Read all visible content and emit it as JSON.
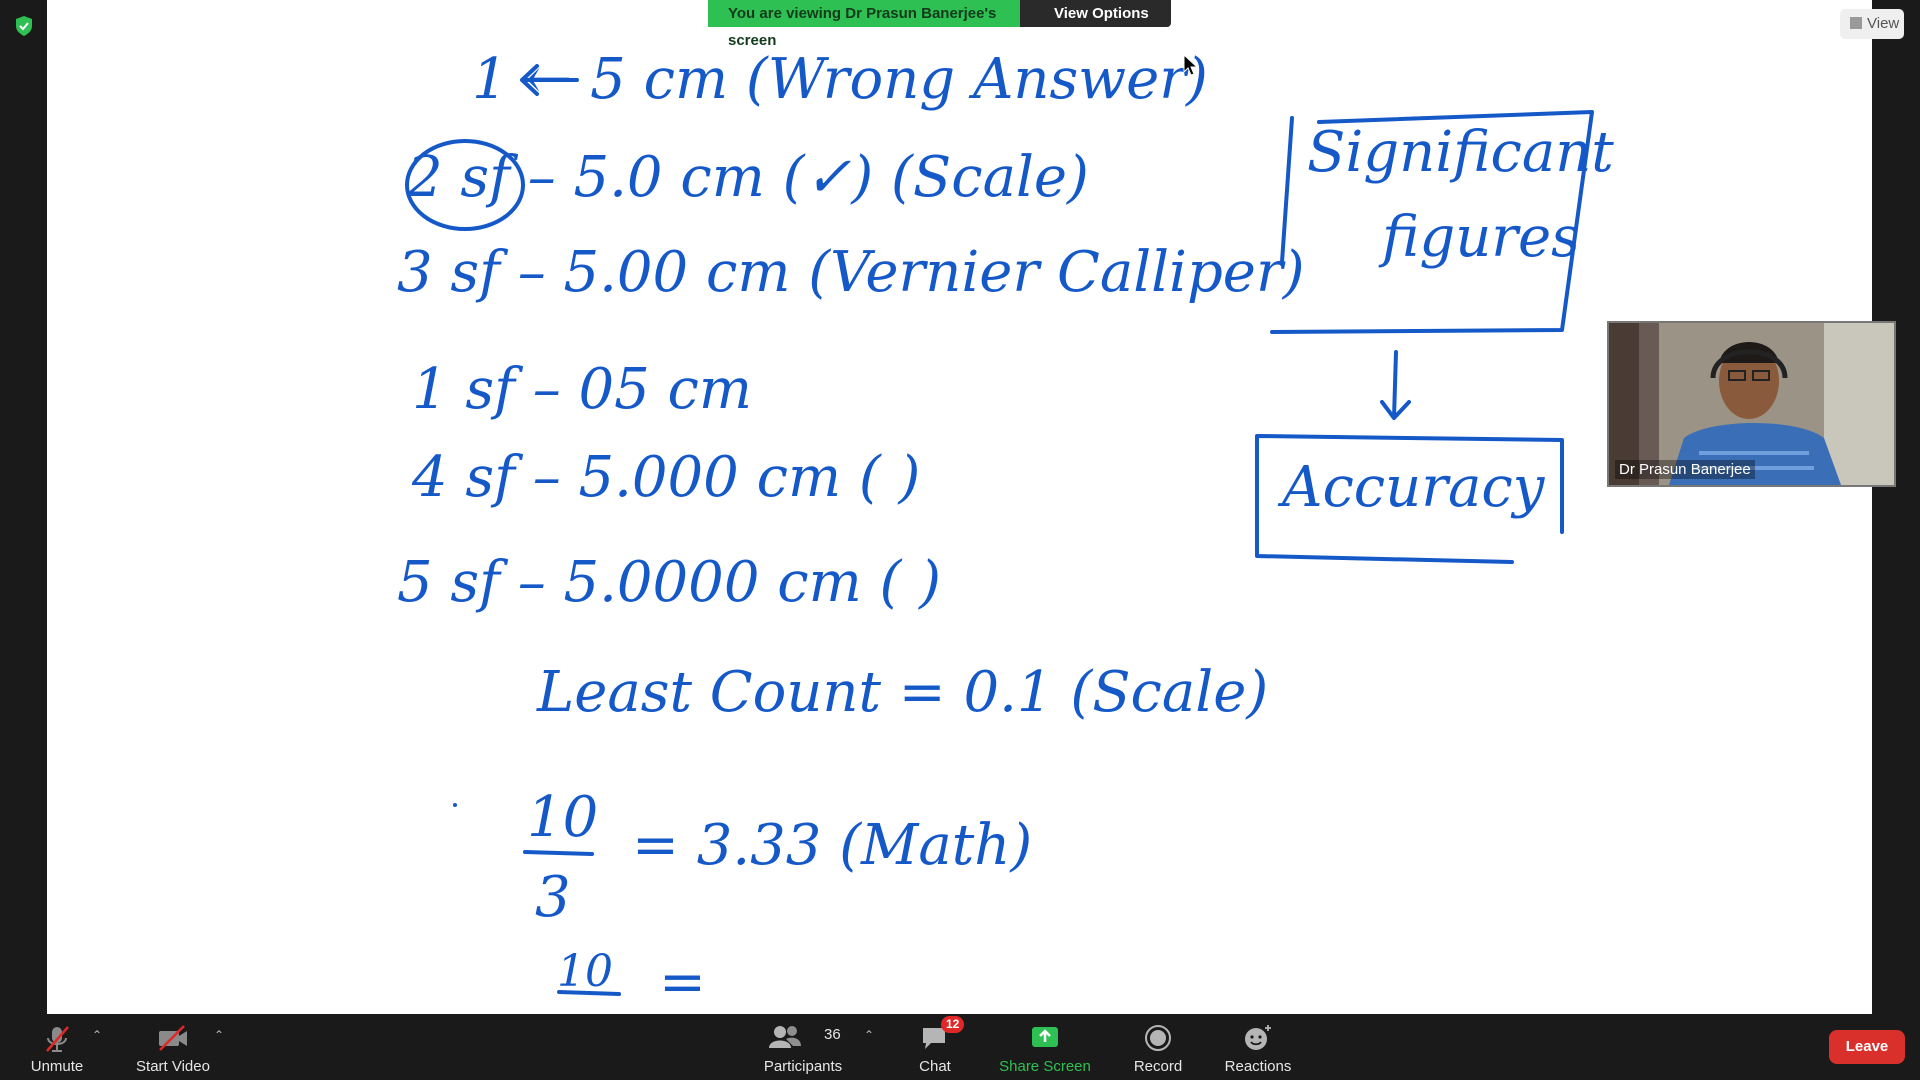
{
  "banner": {
    "viewing_text": "You are viewing Dr Prasun Banerjee's screen",
    "view_options_label": "View Options ⌄"
  },
  "view_button": {
    "label": "View"
  },
  "participant_video": {
    "name": "Dr Prasun Banerjee"
  },
  "whiteboard": {
    "lines": [
      "1 ← 5 cm (Wrong Answer)",
      "2 sf – 5.0 cm (✓) (Scale)",
      "3 sf – 5.00 cm (Vernier Calliper)",
      "1 sf – 05 cm",
      "4 sf – 5.000 cm (     )",
      "5 sf – 5.0000 cm (     )",
      "Least Count = 0.1 (Scale)",
      "= 3.33 (Math)",
      "="
    ],
    "box_significant_line1": "Significant",
    "box_significant_line2": "figures",
    "box_accuracy": "Accuracy",
    "fraction1_num": "10",
    "fraction1_den": "3",
    "fraction2_num": "10"
  },
  "toolbar": {
    "unmute": "Unmute",
    "start_video": "Start Video",
    "participants": "Participants",
    "participants_count": "36",
    "chat": "Chat",
    "chat_badge": "12",
    "share_screen": "Share Screen",
    "record": "Record",
    "reactions": "Reactions",
    "leave": "Leave"
  },
  "colors": {
    "ink": "#1559c8",
    "banner_green": "#2ec052",
    "leave_red": "#d9302c",
    "toolbar_bg": "#1a1a1a"
  }
}
